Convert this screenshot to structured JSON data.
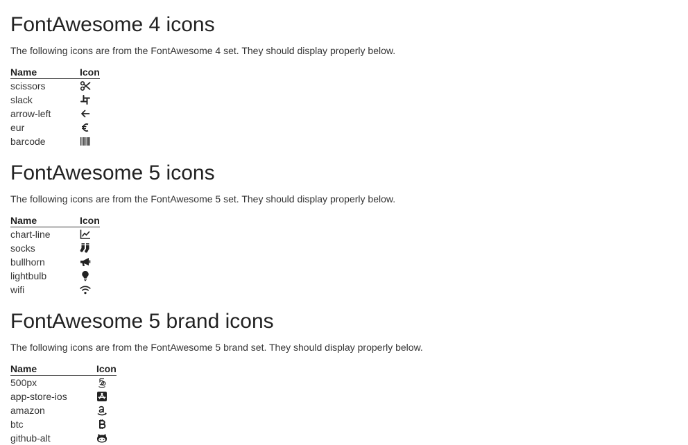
{
  "sections": [
    {
      "title": "FontAwesome 4 icons",
      "description": "The following icons are from the FontAwesome 4 set. They should display properly below.",
      "headers": {
        "name": "Name",
        "icon": "Icon"
      },
      "rows": [
        {
          "name": "scissors",
          "icon": "scissors-icon"
        },
        {
          "name": "slack",
          "icon": "slack-icon"
        },
        {
          "name": "arrow-left",
          "icon": "arrow-left-icon"
        },
        {
          "name": "eur",
          "icon": "euro-icon"
        },
        {
          "name": "barcode",
          "icon": "barcode-icon"
        }
      ]
    },
    {
      "title": "FontAwesome 5 icons",
      "description": "The following icons are from the FontAwesome 5 set. They should display properly below.",
      "headers": {
        "name": "Name",
        "icon": "Icon"
      },
      "rows": [
        {
          "name": "chart-line",
          "icon": "chart-line-icon"
        },
        {
          "name": "socks",
          "icon": "socks-icon"
        },
        {
          "name": "bullhorn",
          "icon": "bullhorn-icon"
        },
        {
          "name": "lightbulb",
          "icon": "lightbulb-icon"
        },
        {
          "name": "wifi",
          "icon": "wifi-icon"
        }
      ]
    },
    {
      "title": "FontAwesome 5 brand icons",
      "description": "The following icons are from the FontAwesome 5 brand set. They should display properly below.",
      "headers": {
        "name": "Name",
        "icon": "Icon"
      },
      "rows": [
        {
          "name": "500px",
          "icon": "500px-icon"
        },
        {
          "name": "app-store-ios",
          "icon": "app-store-ios-icon"
        },
        {
          "name": "amazon",
          "icon": "amazon-icon"
        },
        {
          "name": "btc",
          "icon": "btc-icon"
        },
        {
          "name": "github-alt",
          "icon": "github-alt-icon"
        }
      ]
    }
  ],
  "colors": {
    "text": "#333333",
    "heading": "#222222",
    "background": "#ffffff"
  }
}
